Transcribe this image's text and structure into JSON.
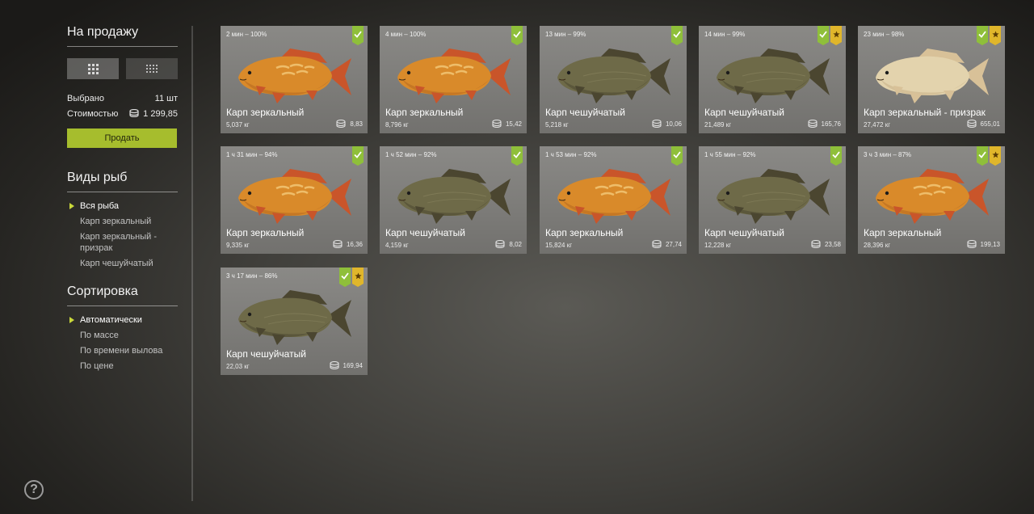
{
  "sidebar": {
    "for_sale_title": "На продажу",
    "selected_label": "Выбрано",
    "selected_value": "11 шт",
    "cost_label": "Стоимостью",
    "cost_value": "1 299,85",
    "sell_button": "Продать",
    "fish_types_title": "Виды рыб",
    "fish_types": [
      "Вся рыба",
      "Карп зеркальный",
      "Карп зеркальный - призрак",
      "Карп чешуйчатый"
    ],
    "fish_types_active": 0,
    "sort_title": "Сортировка",
    "sort_options": [
      "Автоматически",
      "По массе",
      "По времени вылова",
      "По цене"
    ],
    "sort_active": 0,
    "help_glyph": "?"
  },
  "colors": {
    "accent": "#a6bd2d",
    "check_badge": "#8fbf3a",
    "star_badge": "#e0b62b",
    "mirror_carp": "#d98a2a",
    "common_carp": "#6e6a48",
    "ghost_carp": "#e3d3ad"
  },
  "cards": [
    {
      "time": "2 мин – 100%",
      "name": "Карп зеркальный",
      "mass": "5,037 кг",
      "price": "8,83",
      "type": "mirror",
      "star": false
    },
    {
      "time": "4 мин – 100%",
      "name": "Карп зеркальный",
      "mass": "8,796 кг",
      "price": "15,42",
      "type": "mirror",
      "star": false
    },
    {
      "time": "13 мин – 99%",
      "name": "Карп чешуйчатый",
      "mass": "5,218 кг",
      "price": "10,06",
      "type": "common",
      "star": false
    },
    {
      "time": "14 мин – 99%",
      "name": "Карп чешуйчатый",
      "mass": "21,489 кг",
      "price": "165,76",
      "type": "common",
      "star": true
    },
    {
      "time": "23 мин – 98%",
      "name": "Карп зеркальный - призрак",
      "mass": "27,472 кг",
      "price": "655,01",
      "type": "ghost",
      "star": true
    },
    {
      "time": "1 ч 31 мин – 94%",
      "name": "Карп зеркальный",
      "mass": "9,335 кг",
      "price": "16,36",
      "type": "mirror",
      "star": false
    },
    {
      "time": "1 ч 52 мин – 92%",
      "name": "Карп чешуйчатый",
      "mass": "4,159 кг",
      "price": "8,02",
      "type": "common",
      "star": false
    },
    {
      "time": "1 ч 53 мин – 92%",
      "name": "Карп зеркальный",
      "mass": "15,824 кг",
      "price": "27,74",
      "type": "mirror",
      "star": false
    },
    {
      "time": "1 ч 55 мин – 92%",
      "name": "Карп чешуйчатый",
      "mass": "12,228 кг",
      "price": "23,58",
      "type": "common",
      "star": false
    },
    {
      "time": "3 ч 3 мин – 87%",
      "name": "Карп зеркальный",
      "mass": "28,396 кг",
      "price": "199,13",
      "type": "mirror",
      "star": true
    },
    {
      "time": "3 ч 17 мин – 86%",
      "name": "Карп чешуйчатый",
      "mass": "22,03 кг",
      "price": "169,94",
      "type": "common",
      "star": true
    }
  ]
}
